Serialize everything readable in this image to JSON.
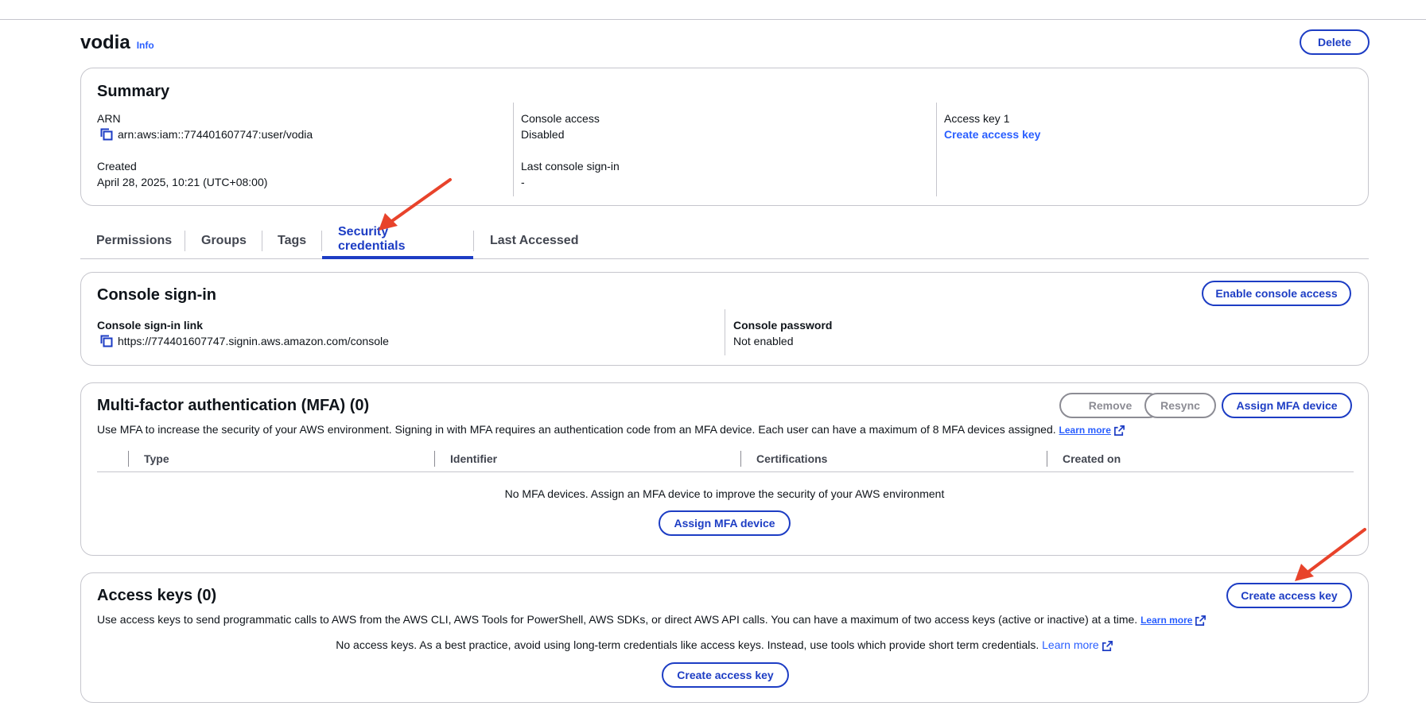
{
  "page": {
    "title": "vodia",
    "info_label": "Info",
    "delete_label": "Delete"
  },
  "summary": {
    "title": "Summary",
    "arn_label": "ARN",
    "arn_value": "arn:aws:iam::774401607747:user/vodia",
    "created_label": "Created",
    "created_value": "April 28, 2025, 10:21 (UTC+08:00)",
    "console_access_label": "Console access",
    "console_access_value": "Disabled",
    "last_signin_label": "Last console sign-in",
    "last_signin_value": "-",
    "access_key_label": "Access key 1",
    "access_key_link": "Create access key"
  },
  "tabs": [
    {
      "label": "Permissions"
    },
    {
      "label": "Groups"
    },
    {
      "label": "Tags"
    },
    {
      "label": "Security credentials",
      "active": true
    },
    {
      "label": "Last Accessed"
    }
  ],
  "console_signin": {
    "title": "Console sign-in",
    "enable_label": "Enable console access",
    "link_label": "Console sign-in link",
    "link_value": "https://774401607747.signin.aws.amazon.com/console",
    "password_label": "Console password",
    "password_value": "Not enabled"
  },
  "mfa": {
    "title": "Multi-factor authentication (MFA) (0)",
    "remove_label": "Remove",
    "resync_label": "Resync",
    "assign_label": "Assign MFA device",
    "description": "Use MFA to increase the security of your AWS environment. Signing in with MFA requires an authentication code from an MFA device. Each user can have a maximum of 8 MFA devices assigned.",
    "learn_more": "Learn more",
    "columns": [
      "Type",
      "Identifier",
      "Certifications",
      "Created on"
    ],
    "empty_text": "No MFA devices. Assign an MFA device to improve the security of your AWS environment",
    "empty_button": "Assign MFA device"
  },
  "access_keys": {
    "title": "Access keys (0)",
    "create_label": "Create access key",
    "description": "Use access keys to send programmatic calls to AWS from the AWS CLI, AWS Tools for PowerShell, AWS SDKs, or direct AWS API calls. You can have a maximum of two access keys (active or inactive) at a time.",
    "learn_more": "Learn more",
    "empty_text": "No access keys. As a best practice, avoid using long-term credentials like access keys. Instead, use tools which provide short term credentials.",
    "empty_learn_more": "Learn more",
    "empty_button": "Create access key"
  },
  "colors": {
    "primary": "#1d3dc4",
    "link": "#295eff",
    "annotation": "#e8432b",
    "border": "#c6c6cd"
  }
}
